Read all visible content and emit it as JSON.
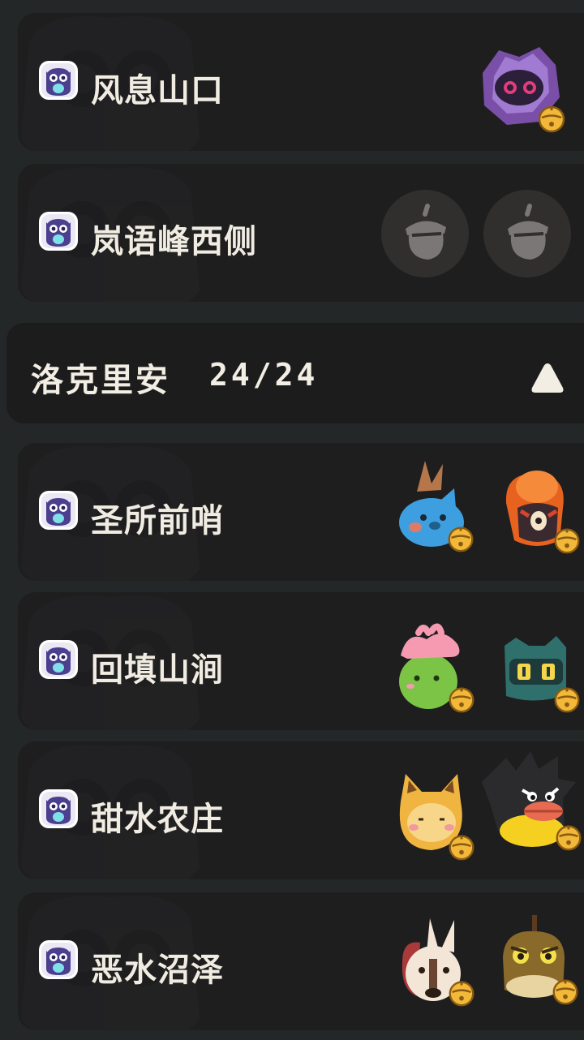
{
  "sections": [
    {
      "type": "location",
      "name": "风息山口",
      "slots": [
        "purple-crystal-bug-creature"
      ]
    },
    {
      "type": "location",
      "name": "岚语峰西侧",
      "slots": [
        "acorn-icon",
        "acorn-icon"
      ]
    }
  ],
  "region": {
    "title": "洛克里安",
    "progress": "24/24",
    "toggle_icon": "triangle-up-icon"
  },
  "locations": [
    {
      "name": "圣所前哨",
      "creatures": [
        "blue-bird-creature",
        "orange-hooded-creature"
      ]
    },
    {
      "name": "回填山涧",
      "creatures": [
        "green-pink-creature",
        "teal-robot-creature"
      ]
    },
    {
      "name": "甜水农庄",
      "creatures": [
        "orange-cat-creature",
        "black-duck-creature"
      ]
    },
    {
      "name": "恶水沼泽",
      "creatures": [
        "donkey-creature",
        "brown-frog-creature"
      ]
    }
  ],
  "colors": {
    "card": "#1e1e1f",
    "background": "#232728",
    "text": "#f1ece2",
    "bell": "#f1b83a"
  }
}
